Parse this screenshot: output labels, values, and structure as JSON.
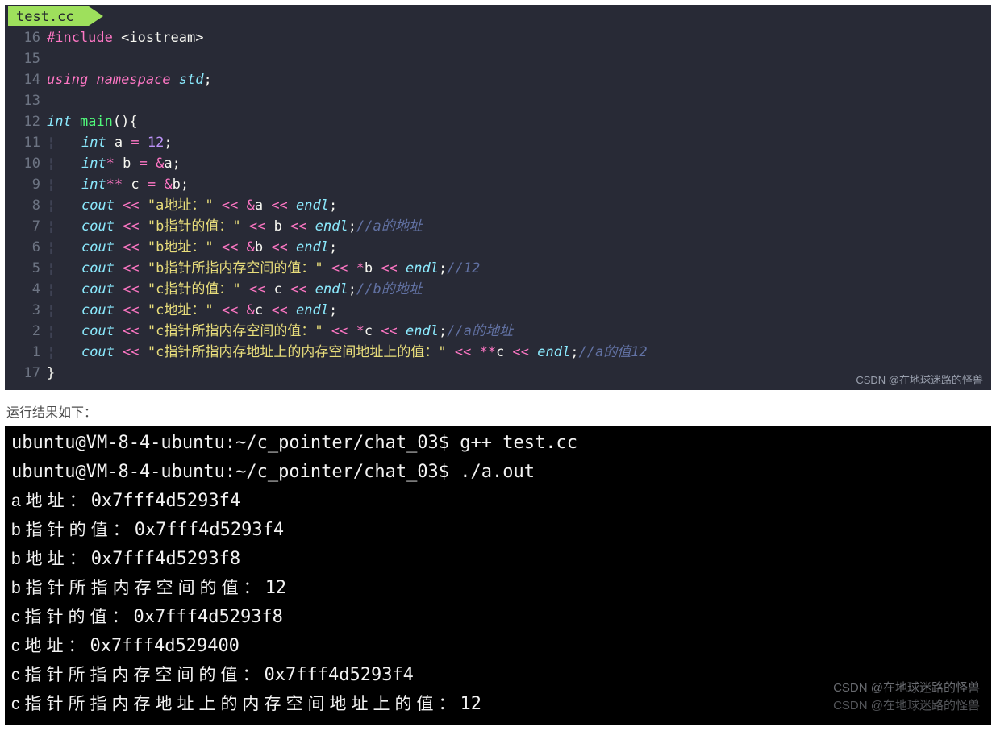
{
  "editor": {
    "tab_label": "test.cc",
    "watermark": "CSDN @在地球迷路的怪兽",
    "lines": [
      {
        "ln": "16",
        "guide": "",
        "tokens": [
          {
            "c": "kw",
            "t": "#include "
          },
          {
            "c": "pl",
            "t": "<iostream>"
          }
        ]
      },
      {
        "ln": "15",
        "guide": "",
        "tokens": []
      },
      {
        "ln": "14",
        "guide": "",
        "tokens": [
          {
            "c": "kw-i",
            "t": "using "
          },
          {
            "c": "kw-i",
            "t": "namespace "
          },
          {
            "c": "cyan",
            "t": "std"
          },
          {
            "c": "pl",
            "t": ";"
          }
        ]
      },
      {
        "ln": "13",
        "guide": "",
        "tokens": []
      },
      {
        "ln": "12",
        "guide": "",
        "tokens": [
          {
            "c": "cyan",
            "t": "int "
          },
          {
            "c": "fn",
            "t": "main"
          },
          {
            "c": "pl",
            "t": "(){"
          }
        ]
      },
      {
        "ln": "11",
        "guide": "¦   ",
        "tokens": [
          {
            "c": "cyan",
            "t": "int "
          },
          {
            "c": "pl",
            "t": "a "
          },
          {
            "c": "op",
            "t": "="
          },
          {
            "c": "pl",
            "t": " "
          },
          {
            "c": "num",
            "t": "12"
          },
          {
            "c": "pl",
            "t": ";"
          }
        ]
      },
      {
        "ln": "10",
        "guide": "¦   ",
        "tokens": [
          {
            "c": "cyan",
            "t": "int"
          },
          {
            "c": "op",
            "t": "* "
          },
          {
            "c": "pl",
            "t": "b "
          },
          {
            "c": "op",
            "t": "="
          },
          {
            "c": "pl",
            "t": " "
          },
          {
            "c": "op",
            "t": "&"
          },
          {
            "c": "pl",
            "t": "a;"
          }
        ]
      },
      {
        "ln": "9",
        "guide": "¦   ",
        "tokens": [
          {
            "c": "cyan",
            "t": "int"
          },
          {
            "c": "op",
            "t": "** "
          },
          {
            "c": "pl",
            "t": "c "
          },
          {
            "c": "op",
            "t": "="
          },
          {
            "c": "pl",
            "t": " "
          },
          {
            "c": "op",
            "t": "&"
          },
          {
            "c": "pl",
            "t": "b;"
          }
        ]
      },
      {
        "ln": "8",
        "guide": "¦   ",
        "tokens": [
          {
            "c": "cyan",
            "t": "cout "
          },
          {
            "c": "op",
            "t": "<<"
          },
          {
            "c": "pl",
            "t": " "
          },
          {
            "c": "str",
            "t": "\"a地址：\""
          },
          {
            "c": "pl",
            "t": " "
          },
          {
            "c": "op",
            "t": "<<"
          },
          {
            "c": "pl",
            "t": " "
          },
          {
            "c": "op",
            "t": "&"
          },
          {
            "c": "pl",
            "t": "a "
          },
          {
            "c": "op",
            "t": "<<"
          },
          {
            "c": "pl",
            "t": " "
          },
          {
            "c": "cyan",
            "t": "endl"
          },
          {
            "c": "pl",
            "t": ";"
          }
        ]
      },
      {
        "ln": "7",
        "guide": "¦   ",
        "tokens": [
          {
            "c": "cyan",
            "t": "cout "
          },
          {
            "c": "op",
            "t": "<<"
          },
          {
            "c": "pl",
            "t": " "
          },
          {
            "c": "str",
            "t": "\"b指针的值：\""
          },
          {
            "c": "pl",
            "t": " "
          },
          {
            "c": "op",
            "t": "<<"
          },
          {
            "c": "pl",
            "t": " b "
          },
          {
            "c": "op",
            "t": "<<"
          },
          {
            "c": "pl",
            "t": " "
          },
          {
            "c": "cyan",
            "t": "endl"
          },
          {
            "c": "pl",
            "t": ";"
          },
          {
            "c": "cm",
            "t": "//a的地址"
          }
        ]
      },
      {
        "ln": "6",
        "guide": "¦   ",
        "tokens": [
          {
            "c": "cyan",
            "t": "cout "
          },
          {
            "c": "op",
            "t": "<<"
          },
          {
            "c": "pl",
            "t": " "
          },
          {
            "c": "str",
            "t": "\"b地址：\""
          },
          {
            "c": "pl",
            "t": " "
          },
          {
            "c": "op",
            "t": "<<"
          },
          {
            "c": "pl",
            "t": " "
          },
          {
            "c": "op",
            "t": "&"
          },
          {
            "c": "pl",
            "t": "b "
          },
          {
            "c": "op",
            "t": "<<"
          },
          {
            "c": "pl",
            "t": " "
          },
          {
            "c": "cyan",
            "t": "endl"
          },
          {
            "c": "pl",
            "t": ";"
          }
        ]
      },
      {
        "ln": "5",
        "guide": "¦   ",
        "tokens": [
          {
            "c": "cyan",
            "t": "cout "
          },
          {
            "c": "op",
            "t": "<<"
          },
          {
            "c": "pl",
            "t": " "
          },
          {
            "c": "str",
            "t": "\"b指针所指内存空间的值：\""
          },
          {
            "c": "pl",
            "t": " "
          },
          {
            "c": "op",
            "t": "<<"
          },
          {
            "c": "pl",
            "t": " "
          },
          {
            "c": "op",
            "t": "*"
          },
          {
            "c": "pl",
            "t": "b "
          },
          {
            "c": "op",
            "t": "<<"
          },
          {
            "c": "pl",
            "t": " "
          },
          {
            "c": "cyan",
            "t": "endl"
          },
          {
            "c": "pl",
            "t": ";"
          },
          {
            "c": "cm",
            "t": "//12"
          }
        ]
      },
      {
        "ln": "4",
        "guide": "¦   ",
        "tokens": [
          {
            "c": "cyan",
            "t": "cout "
          },
          {
            "c": "op",
            "t": "<<"
          },
          {
            "c": "pl",
            "t": " "
          },
          {
            "c": "str",
            "t": "\"c指针的值：\""
          },
          {
            "c": "pl",
            "t": " "
          },
          {
            "c": "op",
            "t": "<<"
          },
          {
            "c": "pl",
            "t": " c "
          },
          {
            "c": "op",
            "t": "<<"
          },
          {
            "c": "pl",
            "t": " "
          },
          {
            "c": "cyan",
            "t": "endl"
          },
          {
            "c": "pl",
            "t": ";"
          },
          {
            "c": "cm",
            "t": "//b的地址"
          }
        ]
      },
      {
        "ln": "3",
        "guide": "¦   ",
        "tokens": [
          {
            "c": "cyan",
            "t": "cout "
          },
          {
            "c": "op",
            "t": "<<"
          },
          {
            "c": "pl",
            "t": " "
          },
          {
            "c": "str",
            "t": "\"c地址：\""
          },
          {
            "c": "pl",
            "t": " "
          },
          {
            "c": "op",
            "t": "<<"
          },
          {
            "c": "pl",
            "t": " "
          },
          {
            "c": "op",
            "t": "&"
          },
          {
            "c": "pl",
            "t": "c "
          },
          {
            "c": "op",
            "t": "<<"
          },
          {
            "c": "pl",
            "t": " "
          },
          {
            "c": "cyan",
            "t": "endl"
          },
          {
            "c": "pl",
            "t": ";"
          }
        ]
      },
      {
        "ln": "2",
        "guide": "¦   ",
        "tokens": [
          {
            "c": "cyan",
            "t": "cout "
          },
          {
            "c": "op",
            "t": "<<"
          },
          {
            "c": "pl",
            "t": " "
          },
          {
            "c": "str",
            "t": "\"c指针所指内存空间的值：\""
          },
          {
            "c": "pl",
            "t": " "
          },
          {
            "c": "op",
            "t": "<<"
          },
          {
            "c": "pl",
            "t": " "
          },
          {
            "c": "op",
            "t": "*"
          },
          {
            "c": "pl",
            "t": "c "
          },
          {
            "c": "op",
            "t": "<<"
          },
          {
            "c": "pl",
            "t": " "
          },
          {
            "c": "cyan",
            "t": "endl"
          },
          {
            "c": "pl",
            "t": ";"
          },
          {
            "c": "cm",
            "t": "//a的地址"
          }
        ]
      },
      {
        "ln": "1",
        "guide": "¦   ",
        "tokens": [
          {
            "c": "cyan",
            "t": "cout "
          },
          {
            "c": "op",
            "t": "<<"
          },
          {
            "c": "pl",
            "t": " "
          },
          {
            "c": "str",
            "t": "\"c指针所指内存地址上的内存空间地址上的值：\""
          },
          {
            "c": "pl",
            "t": " "
          },
          {
            "c": "op",
            "t": "<<"
          },
          {
            "c": "pl",
            "t": " "
          },
          {
            "c": "op",
            "t": "**"
          },
          {
            "c": "pl",
            "t": "c "
          },
          {
            "c": "op",
            "t": "<<"
          },
          {
            "c": "pl",
            "t": " "
          },
          {
            "c": "cyan",
            "t": "endl"
          },
          {
            "c": "pl",
            "t": ";"
          },
          {
            "c": "cm",
            "t": "//a的值12"
          }
        ]
      },
      {
        "ln": "17",
        "guide": "",
        "tokens": [
          {
            "c": "pl",
            "t": "}"
          }
        ]
      }
    ]
  },
  "caption": "运行结果如下：",
  "terminal": {
    "prompt1": "ubuntu@VM-8-4-ubuntu:~/c_pointer/chat_03$ g++ test.cc",
    "prompt2": "ubuntu@VM-8-4-ubuntu:~/c_pointer/chat_03$ ./a.out",
    "lines": [
      {
        "label": "a地址：",
        "value": "0x7fff4d5293f4"
      },
      {
        "label": "b指针的值：",
        "value": "0x7fff4d5293f4"
      },
      {
        "label": "b地址：",
        "value": "0x7fff4d5293f8"
      },
      {
        "label": "b指针所指内存空间的值：",
        "value": "12"
      },
      {
        "label": "c指针的值：",
        "value": "0x7fff4d5293f8"
      },
      {
        "label": "c地址：",
        "value": "0x7fff4d529400"
      },
      {
        "label": "c指针所指内存空间的值：",
        "value": "0x7fff4d5293f4"
      },
      {
        "label": "c指针所指内存地址上的内存空间地址上的值：",
        "value": "12"
      }
    ],
    "watermark1": "CSDN @在地球迷路的怪兽",
    "watermark2": "CSDN @在地球迷路的怪兽"
  }
}
